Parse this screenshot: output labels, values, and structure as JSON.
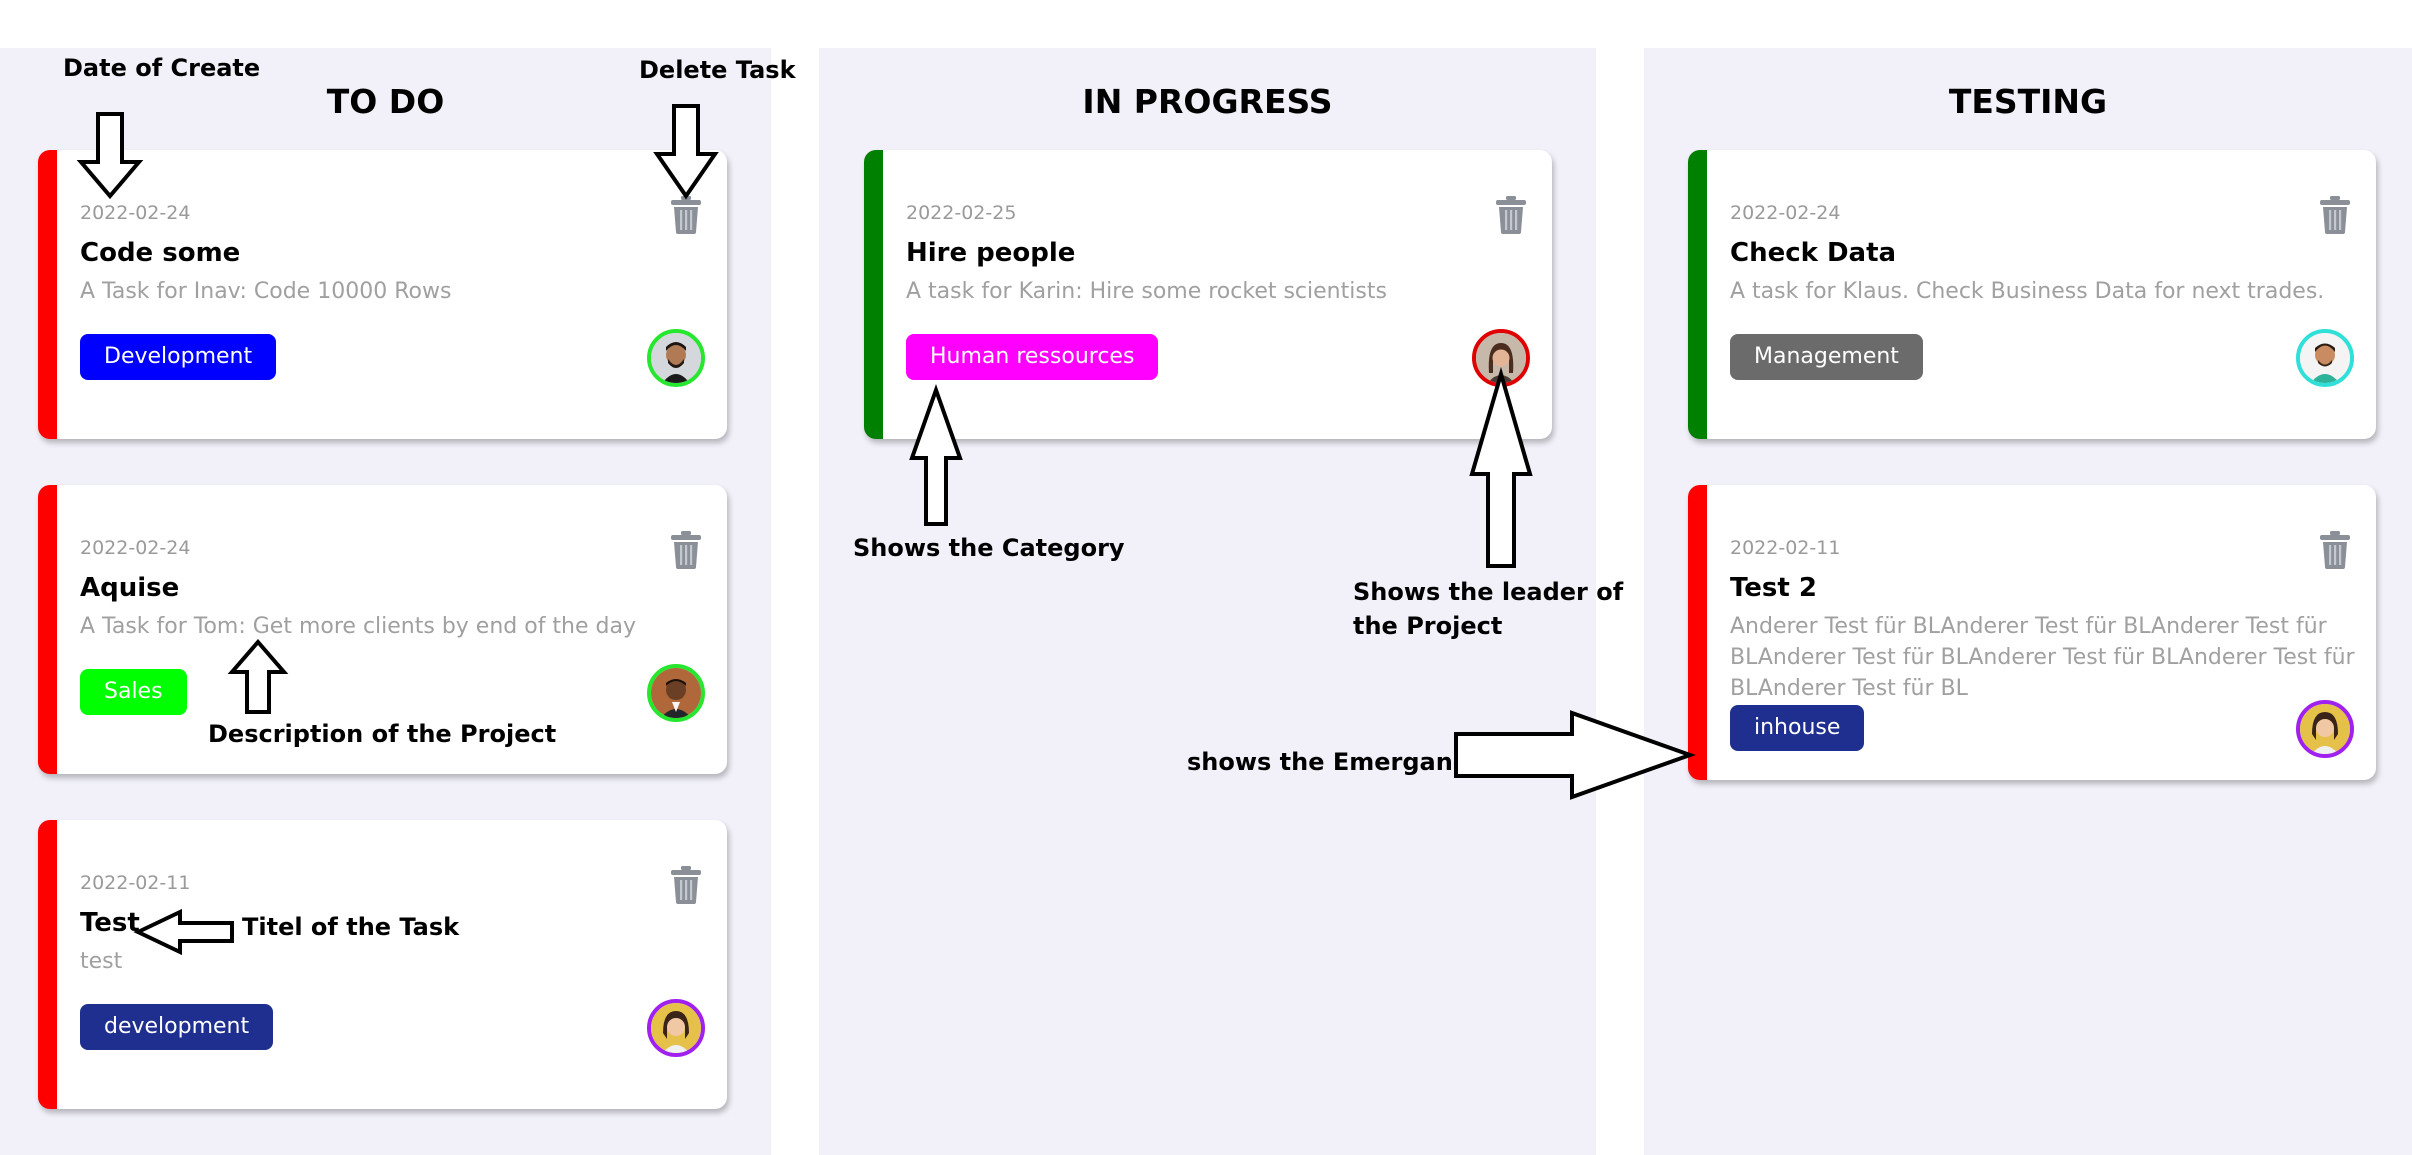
{
  "colors": {
    "urgent": "#ff0000",
    "normal": "#008000",
    "development": "#0000ff",
    "sales": "#00ff00",
    "human_resources": "#ff00ff",
    "management": "#6b6b6b",
    "inhouse": "#1e2f8f",
    "column_bg": "#f2f1f9"
  },
  "columns": [
    {
      "title": "TO DO",
      "cards": [
        {
          "date": "2022-02-24",
          "title": "Code some",
          "description": "A Task for Inav: Code 10000 Rows",
          "category": "Development",
          "icon": "trash-icon",
          "avatar": "avatar-inav"
        },
        {
          "date": "2022-02-24",
          "title": "Aquise",
          "description": "A Task for Tom: Get more clients by end of the day",
          "category": "Sales",
          "icon": "trash-icon",
          "avatar": "avatar-tom"
        },
        {
          "date": "2022-02-11",
          "title": "Test",
          "description": "test",
          "category": "development",
          "icon": "trash-icon",
          "avatar": "avatar-woman"
        }
      ]
    },
    {
      "title": "IN PROGRESS",
      "cards": [
        {
          "date": "2022-02-25",
          "title": "Hire people",
          "description": "A task for Karin: Hire some rocket scientists",
          "category": "Human ressources",
          "icon": "trash-icon",
          "avatar": "avatar-karin"
        }
      ]
    },
    {
      "title": "TESTING",
      "cards": [
        {
          "date": "2022-02-24",
          "title": "Check Data",
          "description": "A task for Klaus. Check Business Data for next trades.",
          "category": "Management",
          "icon": "trash-icon",
          "avatar": "avatar-klaus"
        },
        {
          "date": "2022-02-11",
          "title": "Test 2",
          "description": "Anderer Test für BLAnderer Test für BLAnderer Test für BLAnderer Test für BLAnderer Test für BLAnderer Test für BLAnderer Test für BL",
          "category": "inhouse",
          "icon": "trash-icon",
          "avatar": "avatar-woman"
        }
      ]
    }
  ],
  "annotations": {
    "date_of_create": "Date of Create",
    "delete_task": "Delete Task",
    "description_of_project": "Description of the Project",
    "title_of_task": "Titel of the Task",
    "shows_category": "Shows the Category",
    "shows_leader": "Shows the leader of the Project",
    "shows_emergency": "shows the Emergancy"
  }
}
